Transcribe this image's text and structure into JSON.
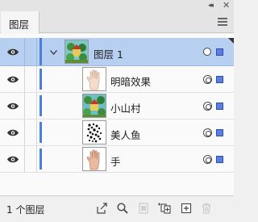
{
  "panel": {
    "tab_label": "图层",
    "collapse_glyph": "◂◂",
    "close_glyph": "✕"
  },
  "layers": [
    {
      "name": "图层 1",
      "is_parent": true,
      "expanded": true,
      "thumb": "landscape-thumbnail"
    },
    {
      "name": "明暗效果",
      "is_parent": false,
      "thumb": "hand-thumbnail"
    },
    {
      "name": "小山村",
      "is_parent": false,
      "thumb": "village-thumbnail"
    },
    {
      "name": "美人鱼",
      "is_parent": false,
      "thumb": "mermaid-thumbnail"
    },
    {
      "name": "手",
      "is_parent": false,
      "thumb": "hand-thumbnail"
    }
  ],
  "footer": {
    "count_label": "1 个图层"
  },
  "colors": {
    "selection_bg": "#b7cff0",
    "layer_color": "#4a7fd9",
    "select_square": "#5b7ee6"
  }
}
